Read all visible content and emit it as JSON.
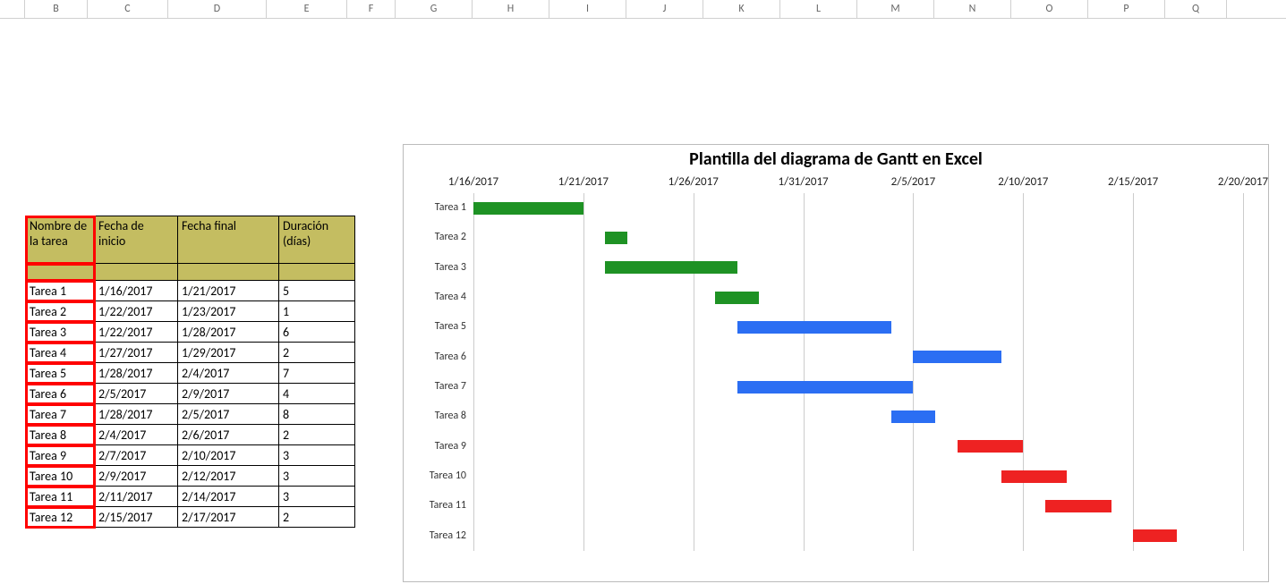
{
  "ruler_columns": [
    {
      "label": "",
      "w": 28
    },
    {
      "label": "B",
      "w": 70
    },
    {
      "label": "C",
      "w": 90
    },
    {
      "label": "D",
      "w": 110
    },
    {
      "label": "E",
      "w": 90
    },
    {
      "label": "F",
      "w": 54
    },
    {
      "label": "G",
      "w": 86
    },
    {
      "label": "H",
      "w": 86
    },
    {
      "label": "I",
      "w": 86
    },
    {
      "label": "J",
      "w": 86
    },
    {
      "label": "K",
      "w": 86
    },
    {
      "label": "L",
      "w": 86
    },
    {
      "label": "M",
      "w": 86
    },
    {
      "label": "N",
      "w": 86
    },
    {
      "label": "O",
      "w": 86
    },
    {
      "label": "P",
      "w": 86
    },
    {
      "label": "Q",
      "w": 69
    }
  ],
  "table": {
    "headers": {
      "task": "Nombre de la tarea",
      "start": "Fecha de inicio",
      "end": "Fecha final",
      "duration": "Duración (días)"
    },
    "rows": [
      {
        "task": "Tarea 1",
        "start": "1/16/2017",
        "end": "1/21/2017",
        "dur": "5"
      },
      {
        "task": "Tarea 2",
        "start": "1/22/2017",
        "end": "1/23/2017",
        "dur": "1"
      },
      {
        "task": "Tarea 3",
        "start": "1/22/2017",
        "end": "1/28/2017",
        "dur": "6"
      },
      {
        "task": "Tarea 4",
        "start": "1/27/2017",
        "end": "1/29/2017",
        "dur": "2"
      },
      {
        "task": "Tarea 5",
        "start": "1/28/2017",
        "end": "2/4/2017",
        "dur": "7"
      },
      {
        "task": "Tarea 6",
        "start": "2/5/2017",
        "end": "2/9/2017",
        "dur": "4"
      },
      {
        "task": "Tarea 7",
        "start": "1/28/2017",
        "end": "2/5/2017",
        "dur": "8"
      },
      {
        "task": "Tarea 8",
        "start": "2/4/2017",
        "end": "2/6/2017",
        "dur": "2"
      },
      {
        "task": "Tarea 9",
        "start": "2/7/2017",
        "end": "2/10/2017",
        "dur": "3"
      },
      {
        "task": "Tarea 10",
        "start": "2/9/2017",
        "end": "2/12/2017",
        "dur": "3"
      },
      {
        "task": "Tarea 11",
        "start": "2/11/2017",
        "end": "2/14/2017",
        "dur": "3"
      },
      {
        "task": "Tarea 12",
        "start": "2/15/2017",
        "end": "2/17/2017",
        "dur": "2"
      }
    ]
  },
  "chart_data": {
    "type": "gantt",
    "title": "Plantilla del diagrama de Gantt en Excel",
    "x_axis": {
      "min": "1/16/2017",
      "max": "2/20/2017",
      "ticks": [
        "1/16/2017",
        "1/21/2017",
        "1/26/2017",
        "1/31/2017",
        "2/5/2017",
        "2/10/2017",
        "2/15/2017",
        "2/20/2017"
      ]
    },
    "categories": [
      "Tarea 1",
      "Tarea 2",
      "Tarea 3",
      "Tarea 4",
      "Tarea 5",
      "Tarea 6",
      "Tarea 7",
      "Tarea 8",
      "Tarea 9",
      "Tarea 10",
      "Tarea 11",
      "Tarea 12"
    ],
    "bars": [
      {
        "task": "Tarea 1",
        "start": "1/16/2017",
        "duration_days": 5,
        "color": "green"
      },
      {
        "task": "Tarea 2",
        "start": "1/22/2017",
        "duration_days": 1,
        "color": "green"
      },
      {
        "task": "Tarea 3",
        "start": "1/22/2017",
        "duration_days": 6,
        "color": "green"
      },
      {
        "task": "Tarea 4",
        "start": "1/27/2017",
        "duration_days": 2,
        "color": "green"
      },
      {
        "task": "Tarea 5",
        "start": "1/28/2017",
        "duration_days": 7,
        "color": "blue"
      },
      {
        "task": "Tarea 6",
        "start": "2/5/2017",
        "duration_days": 4,
        "color": "blue"
      },
      {
        "task": "Tarea 7",
        "start": "1/28/2017",
        "duration_days": 8,
        "color": "blue"
      },
      {
        "task": "Tarea 8",
        "start": "2/4/2017",
        "duration_days": 2,
        "color": "blue"
      },
      {
        "task": "Tarea 9",
        "start": "2/7/2017",
        "duration_days": 3,
        "color": "red"
      },
      {
        "task": "Tarea 10",
        "start": "2/9/2017",
        "duration_days": 3,
        "color": "red"
      },
      {
        "task": "Tarea 11",
        "start": "2/11/2017",
        "duration_days": 3,
        "color": "red"
      },
      {
        "task": "Tarea 12",
        "start": "2/15/2017",
        "duration_days": 2,
        "color": "red"
      }
    ]
  }
}
